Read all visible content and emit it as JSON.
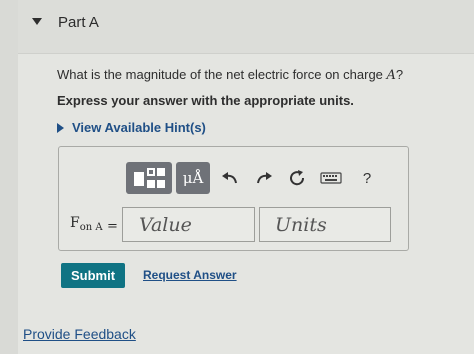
{
  "part": {
    "title": "Part A"
  },
  "question": {
    "text_before": "What is the magnitude of the net electric force on charge ",
    "variable": "A",
    "text_after": "?"
  },
  "instruction": "Express your answer with the appropriate units.",
  "hint_link": "View Available Hint(s)",
  "toolbar": {
    "units_glyph": "μÅ",
    "help_glyph": "?"
  },
  "answer": {
    "label_main": "F",
    "label_sub": "on A",
    "equals": "=",
    "value_placeholder": "Value",
    "units_placeholder": "Units"
  },
  "actions": {
    "submit_label": "Submit",
    "request_label": "Request Answer"
  },
  "footer": {
    "feedback_label": "Provide Feedback"
  },
  "colors": {
    "link": "#1f4f86",
    "submit_bg": "#0f7383",
    "toolbar_btn": "#6f7278"
  }
}
